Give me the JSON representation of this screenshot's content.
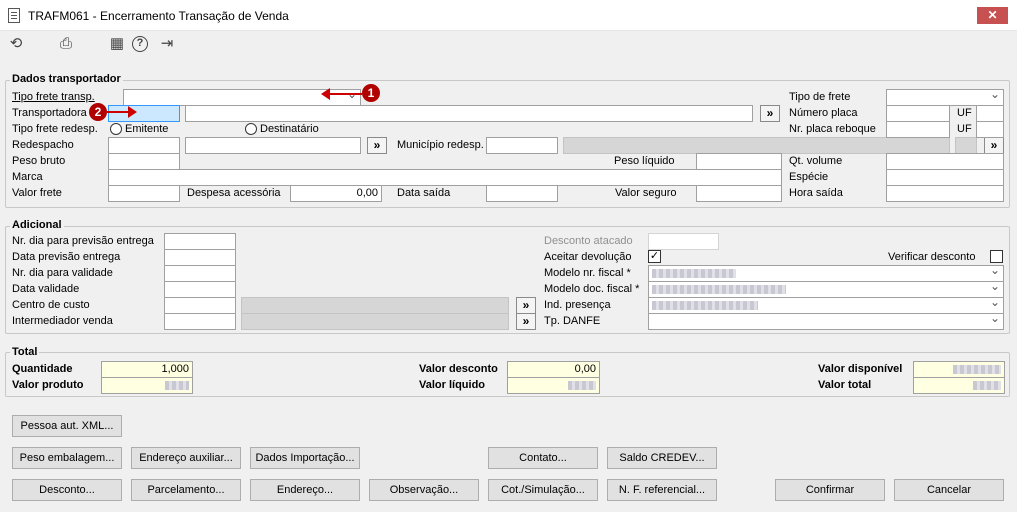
{
  "window": {
    "title": "TRAFM061 - Encerramento Transação de Venda",
    "close": "✕"
  },
  "toolbar": {
    "refresh": "⟲",
    "print": "⎙",
    "calendar": "▦",
    "help": "?",
    "exit": "⇥"
  },
  "transp": {
    "title": "Dados transportador",
    "tipo_frete_transp": "Tipo frete transp.",
    "transportadora": "Transportadora",
    "tipo_frete_redesp": "Tipo frete redesp.",
    "emitente": "Emitente",
    "destinatario": "Destinatário",
    "redespacho": "Redespacho",
    "municipio_redesp": "Município redesp.",
    "peso_bruto": "Peso bruto",
    "peso_liquido": "Peso líquido",
    "marca": "Marca",
    "valor_frete": "Valor frete",
    "despesa_acessoria": "Despesa acessória",
    "despesa_value": "0,00",
    "data_saida": "Data saída",
    "valor_seguro": "Valor seguro",
    "tipo_de_frete": "Tipo de frete",
    "numero_placa": "Número placa",
    "nr_placa_reboque": "Nr. placa reboque",
    "uf": "UF",
    "qt_volume": "Qt. volume",
    "especie": "Espécie",
    "hora_saida": "Hora saída",
    "lookup": "»"
  },
  "markers": {
    "m1": "1",
    "m2": "2"
  },
  "adicional": {
    "title": "Adicional",
    "nr_dia_previsao": "Nr. dia para previsão entrega",
    "data_previsao": "Data previsão entrega",
    "nr_dia_validade": "Nr. dia para validade",
    "data_validade": "Data validade",
    "centro_custo": "Centro de custo",
    "intermediador": "Intermediador venda",
    "desconto_atacado": "Desconto atacado",
    "aceitar_devolucao": "Aceitar devolução",
    "aceitar_check": "✓",
    "verificar_desconto": "Verificar desconto",
    "modelo_nr_fiscal": "Modelo nr. fiscal *",
    "modelo_doc_fiscal": "Modelo doc. fiscal *",
    "ind_presenca": "Ind. presença",
    "tp_danfe": "Tp. DANFE"
  },
  "total": {
    "title": "Total",
    "quantidade": "Quantidade",
    "quantidade_value": "1,000",
    "valor_produto": "Valor produto",
    "valor_desconto": "Valor desconto",
    "valor_desconto_value": "0,00",
    "valor_liquido": "Valor líquido",
    "valor_disponivel": "Valor disponível",
    "valor_total": "Valor total"
  },
  "buttons": {
    "pessoa_xml": "Pessoa aut. XML...",
    "peso_embalagem": "Peso embalagem...",
    "endereco_auxiliar": "Endereço auxiliar...",
    "dados_importacao": "Dados Importação...",
    "contato": "Contato...",
    "saldo_credev": "Saldo CREDEV...",
    "desconto": "Desconto...",
    "parcelamento": "Parcelamento...",
    "endereco": "Endereço...",
    "observacao": "Observação...",
    "cot_simulacao": "Cot./Simulação...",
    "nf_referencial": "N. F. referencial...",
    "confirmar": "Confirmar",
    "cancelar": "Cancelar"
  }
}
